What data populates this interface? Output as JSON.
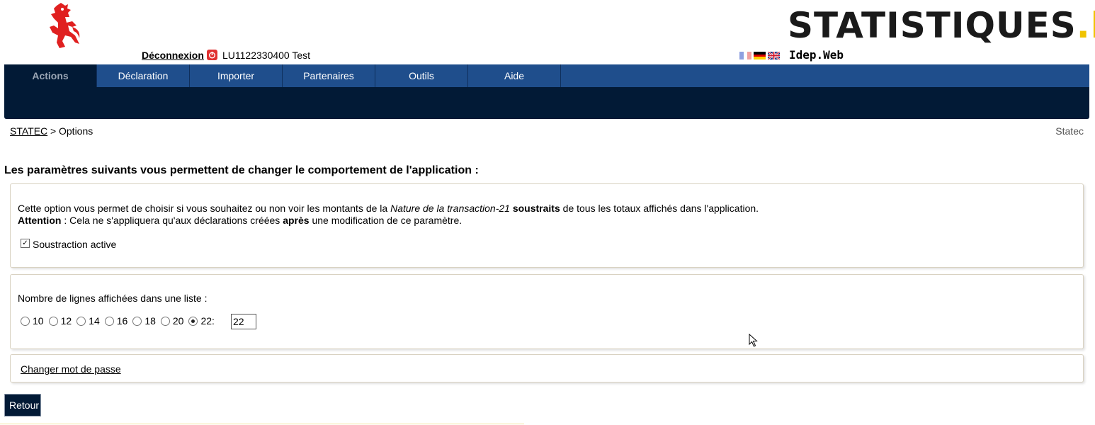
{
  "header": {
    "brand_main": "STATISTIQUES",
    "brand_dot": ".",
    "brand_suffix": "lu",
    "logout_label": "Déconnexion",
    "user_label": "LU1122330400 Test",
    "app_name": "Idep.Web",
    "languages": [
      "fr",
      "de",
      "en"
    ]
  },
  "nav": {
    "tabs": [
      "Actions",
      "Déclaration",
      "Importer",
      "Partenaires",
      "Outils",
      "Aide"
    ],
    "active": "Actions"
  },
  "breadcrumb": {
    "root": "STATEC",
    "separator": ">",
    "current": "Options",
    "right": "Statec"
  },
  "page": {
    "intro": "Les paramètres suivants vous permettent de changer le comportement de l'application :"
  },
  "option_subtraction": {
    "text_1": "Cette option vous permet de choisir si vous souhaitez ou non voir les montants de la ",
    "text_italic": "Nature de la transaction-21",
    "text_2": " ",
    "text_bold": "soustraits",
    "text_3": " de tous les totaux affichés dans l'application.",
    "attention_label": "Attention",
    "attention_1": " : Cela ne s'appliquera qu'aux déclarations créées ",
    "attention_bold": "après",
    "attention_2": " une modification de ce paramètre.",
    "checkbox_label": "Soustraction active",
    "checked": true
  },
  "option_lines": {
    "label": "Nombre de lignes affichées dans une liste :",
    "options": [
      "10",
      "12",
      "14",
      "16",
      "18",
      "20",
      "22:"
    ],
    "selected": "22:",
    "custom_value": "22"
  },
  "password": {
    "link_label": "Changer mot de passe"
  },
  "actions": {
    "back_label": "Retour"
  },
  "colors": {
    "nav_blue": "#1f4e8c",
    "nav_dark": "#021a36",
    "brand_yellow": "#f0c300",
    "lion_red": "#e02020"
  }
}
